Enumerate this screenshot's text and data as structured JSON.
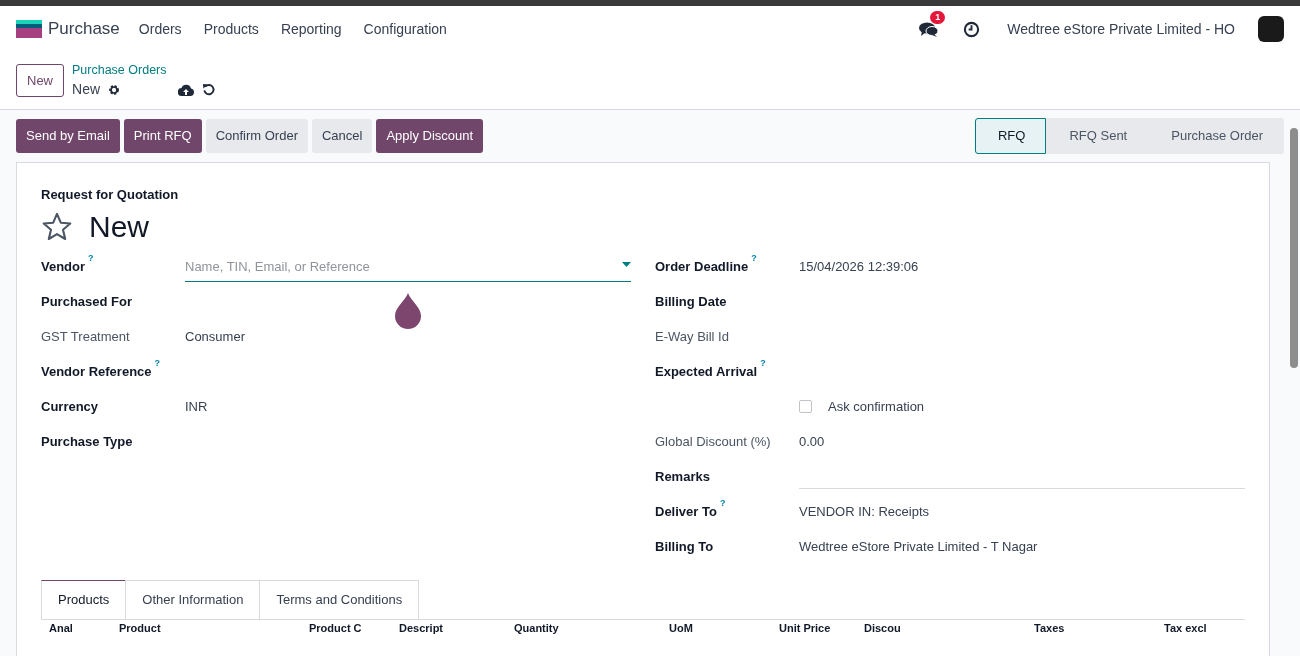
{
  "navbar": {
    "app": "Purchase",
    "menu": [
      "Orders",
      "Products",
      "Reporting",
      "Configuration"
    ],
    "chat_badge": "1",
    "company": "Wedtree eStore Private Limited - HO"
  },
  "control_panel": {
    "new_button": "New",
    "breadcrumb": "Purchase Orders",
    "record": "New"
  },
  "actions": [
    {
      "label": "Send by Email",
      "kind": "primary"
    },
    {
      "label": "Print RFQ",
      "kind": "primary"
    },
    {
      "label": "Confirm Order",
      "kind": "secondary"
    },
    {
      "label": "Cancel",
      "kind": "secondary"
    },
    {
      "label": "Apply Discount",
      "kind": "primary"
    }
  ],
  "statusbar": [
    {
      "label": "RFQ",
      "selected": true
    },
    {
      "label": "RFQ Sent",
      "selected": false
    },
    {
      "label": "Purchase Order",
      "selected": false
    }
  ],
  "form": {
    "subtitle": "Request for Quotation",
    "title": "New",
    "starred": false,
    "left": [
      {
        "label": "Vendor",
        "help": "?",
        "kind": "input",
        "placeholder": "Name, TIN, Email, or Reference",
        "bold": true
      },
      {
        "label": "Purchased For",
        "kind": "text",
        "bold": true
      },
      {
        "label": "GST Treatment",
        "kind": "text",
        "value": "Consumer",
        "bold": false
      },
      {
        "label": "Vendor Reference",
        "help": "?",
        "kind": "text",
        "bold": true
      },
      {
        "label": "Currency",
        "kind": "text",
        "value": "INR",
        "bold": true
      },
      {
        "label": "Purchase Type",
        "kind": "text",
        "bold": true
      }
    ],
    "right": [
      {
        "label": "Order Deadline",
        "help": "?",
        "kind": "text",
        "value": "15/04/2026 12:39:06",
        "bold": true
      },
      {
        "label": "Billing Date",
        "kind": "text",
        "bold": true
      },
      {
        "label": "E-Way Bill Id",
        "kind": "text",
        "bold": false
      },
      {
        "label": "Expected Arrival",
        "help": "?",
        "kind": "text",
        "bold": true
      },
      {
        "kind": "checkbox",
        "value": "Ask confirmation",
        "checked": false
      },
      {
        "label": "Global Discount (%)",
        "kind": "text",
        "value": "0.00",
        "bold": false
      },
      {
        "label": "Remarks",
        "kind": "line",
        "bold": true
      },
      {
        "label": "Deliver To",
        "help": "?",
        "kind": "text",
        "value": "VENDOR IN: Receipts",
        "bold": true
      },
      {
        "label": "Billing To",
        "kind": "text",
        "value": "Wedtree eStore Private Limited - T Nagar",
        "bold": true
      }
    ],
    "tabs": [
      {
        "label": "Products",
        "selected": true
      },
      {
        "label": "Other Information",
        "selected": false
      },
      {
        "label": "Terms and Conditions",
        "selected": false
      }
    ],
    "columns": [
      "Anal",
      "Product",
      "Product C",
      "Descript",
      "Quantity",
      "UoM",
      "Unit Price",
      "Discou",
      "Taxes",
      "Tax excl"
    ]
  }
}
